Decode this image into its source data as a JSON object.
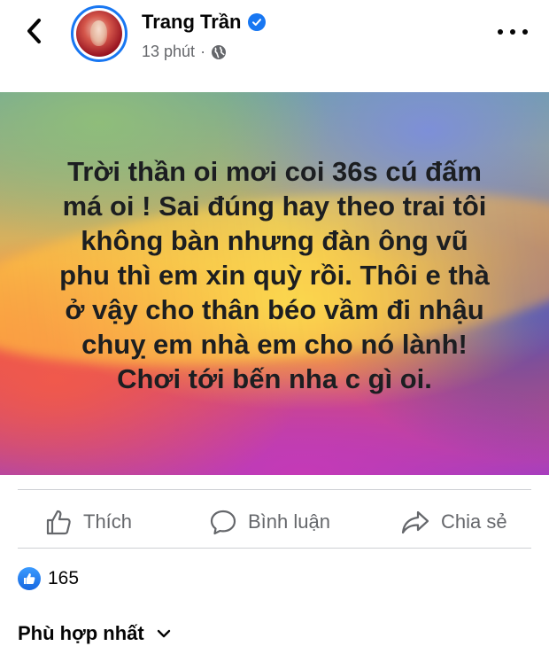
{
  "header": {
    "author_name": "Trang Trần",
    "timestamp": "13 phút",
    "separator": "·",
    "privacy_icon": "globe-icon",
    "verified_icon": "verified-badge-icon",
    "back_icon": "chevron-left-icon",
    "more_icon": "more-horizontal-icon"
  },
  "post": {
    "text": "Trời thần oi mơi coi 36s cú đấm\nmá oi ! Sai đúng hay theo trai tôi\nkhông bàn nhưng đàn ông vũ\nphu thì em xin quỳ rồi. Thôi e thà\nở vậy cho thân béo vầm đi nhậu\nchuỵ em nhà em cho nó lành!\nChơi tới bến nha c gì oi."
  },
  "actions": {
    "like_label": "Thích",
    "comment_label": "Bình luận",
    "share_label": "Chia sẻ"
  },
  "reactions": {
    "count": "165",
    "icon": "like-reaction-icon"
  },
  "comments": {
    "sort_label": "Phù hợp nhất"
  },
  "colors": {
    "accent": "#1877f2",
    "secondary_text": "#65676b",
    "divider": "#ced0d4"
  }
}
